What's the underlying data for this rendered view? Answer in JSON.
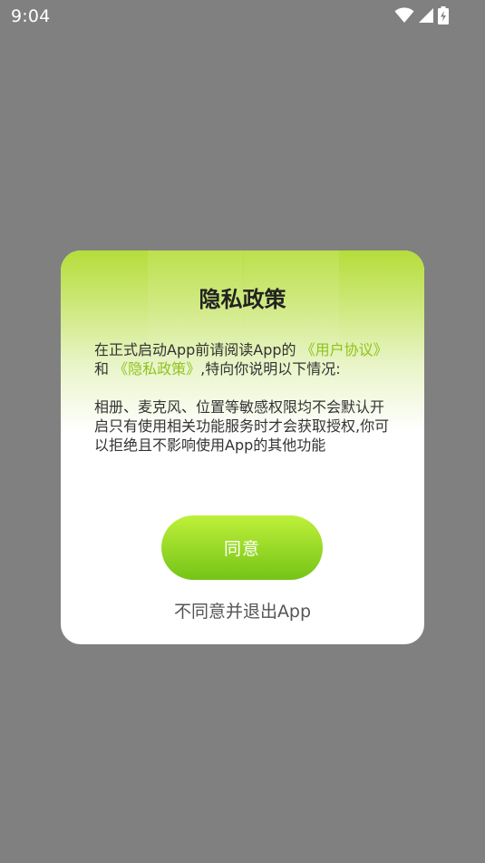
{
  "status_bar": {
    "time": "9:04",
    "icons": [
      "wifi-icon",
      "cellular-signal-icon",
      "battery-charging-icon"
    ]
  },
  "dialog": {
    "title": "隐私政策",
    "intro_prefix": "在正式启动App前请阅读App的",
    "link_user_agreement": "《用户协议》",
    "connector": "和",
    "link_privacy_policy": "《隐私政策》",
    "intro_suffix": ",特向你说明以下情况:",
    "permissions_text": "相册、麦克风、位置等敏感权限均不会默认开启只有使用相关功能服务时才会获取授权,你可以拒绝且不影响使用App的其他功能",
    "agree_label": "同意",
    "disagree_label": "不同意并退出App"
  },
  "colors": {
    "overlay": "#808080",
    "accent_green": "#8fc31f",
    "button_top": "#bff03a",
    "button_bottom": "#74c417"
  }
}
